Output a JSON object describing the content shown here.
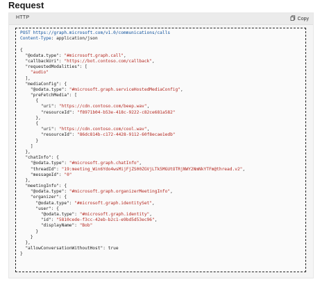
{
  "heading": "Request",
  "code_block": {
    "language": "HTTP",
    "copy_label": "Copy",
    "lines": [
      {
        "indent": 0,
        "parts": [
          {
            "t": "u",
            "v": "POST https://graph.microsoft.com/v1.0/communications/calls"
          }
        ]
      },
      {
        "indent": 0,
        "parts": [
          {
            "t": "u",
            "v": "Content-Type"
          },
          {
            "t": "p",
            "v": ": application/json"
          }
        ]
      },
      {
        "indent": 0,
        "parts": []
      },
      {
        "indent": 0,
        "parts": [
          {
            "t": "p",
            "v": "{"
          }
        ]
      },
      {
        "indent": 1,
        "parts": [
          {
            "t": "k",
            "v": "\"@odata.type\""
          },
          {
            "t": "p",
            "v": ": "
          },
          {
            "t": "s",
            "v": "\"#microsoft.graph.call\""
          },
          {
            "t": "p",
            "v": ","
          }
        ]
      },
      {
        "indent": 1,
        "parts": [
          {
            "t": "k",
            "v": "\"callbackUri\""
          },
          {
            "t": "p",
            "v": ": "
          },
          {
            "t": "s",
            "v": "\"https://bot.contoso.com/callback\""
          },
          {
            "t": "p",
            "v": ","
          }
        ]
      },
      {
        "indent": 1,
        "parts": [
          {
            "t": "k",
            "v": "\"requestedModalities\""
          },
          {
            "t": "p",
            "v": ": ["
          }
        ]
      },
      {
        "indent": 2,
        "parts": [
          {
            "t": "s",
            "v": "\"audio\""
          }
        ]
      },
      {
        "indent": 1,
        "parts": [
          {
            "t": "p",
            "v": "],"
          }
        ]
      },
      {
        "indent": 1,
        "parts": [
          {
            "t": "k",
            "v": "\"mediaConfig\""
          },
          {
            "t": "p",
            "v": ": {"
          }
        ]
      },
      {
        "indent": 2,
        "parts": [
          {
            "t": "k",
            "v": "\"@odata.type\""
          },
          {
            "t": "p",
            "v": ": "
          },
          {
            "t": "s",
            "v": "\"#microsoft.graph.serviceHostedMediaConfig\""
          },
          {
            "t": "p",
            "v": ","
          }
        ]
      },
      {
        "indent": 2,
        "parts": [
          {
            "t": "k",
            "v": "\"preFetchMedia\""
          },
          {
            "t": "p",
            "v": ": ["
          }
        ]
      },
      {
        "indent": 3,
        "parts": [
          {
            "t": "p",
            "v": "{"
          }
        ]
      },
      {
        "indent": 4,
        "parts": [
          {
            "t": "k",
            "v": "\"uri\""
          },
          {
            "t": "p",
            "v": ": "
          },
          {
            "t": "s",
            "v": "\"https://cdn.contoso.com/beep.wav\""
          },
          {
            "t": "p",
            "v": ","
          }
        ]
      },
      {
        "indent": 4,
        "parts": [
          {
            "t": "k",
            "v": "\"resourceId\""
          },
          {
            "t": "p",
            "v": ": "
          },
          {
            "t": "s",
            "v": "\"f8971b04-b53e-418c-9222-c82ce681a582\""
          }
        ]
      },
      {
        "indent": 3,
        "parts": [
          {
            "t": "p",
            "v": "},"
          }
        ]
      },
      {
        "indent": 3,
        "parts": [
          {
            "t": "p",
            "v": "{"
          }
        ]
      },
      {
        "indent": 4,
        "parts": [
          {
            "t": "k",
            "v": "\"uri\""
          },
          {
            "t": "p",
            "v": ": "
          },
          {
            "t": "s",
            "v": "\"https://cdn.contoso.com/cool.wav\""
          },
          {
            "t": "p",
            "v": ","
          }
        ]
      },
      {
        "indent": 4,
        "parts": [
          {
            "t": "k",
            "v": "\"resourceId\""
          },
          {
            "t": "p",
            "v": ": "
          },
          {
            "t": "s",
            "v": "\"86dc814b-c172-4428-9112-60f8ecae1edb\""
          }
        ]
      },
      {
        "indent": 3,
        "parts": [
          {
            "t": "p",
            "v": "}"
          }
        ]
      },
      {
        "indent": 2,
        "parts": [
          {
            "t": "p",
            "v": "]"
          }
        ]
      },
      {
        "indent": 1,
        "parts": [
          {
            "t": "p",
            "v": "},"
          }
        ]
      },
      {
        "indent": 1,
        "parts": [
          {
            "t": "k",
            "v": "\"chatInfo\""
          },
          {
            "t": "p",
            "v": ": {"
          }
        ]
      },
      {
        "indent": 2,
        "parts": [
          {
            "t": "k",
            "v": "\"@odata.type\""
          },
          {
            "t": "p",
            "v": ": "
          },
          {
            "t": "s",
            "v": "\"#microsoft.graph.chatInfo\""
          },
          {
            "t": "p",
            "v": ","
          }
        ]
      },
      {
        "indent": 2,
        "parts": [
          {
            "t": "k",
            "v": "\"threadId\""
          },
          {
            "t": "p",
            "v": ": "
          },
          {
            "t": "s",
            "v": "\"19:meeting_Win6Ydo4wsMijFjZS00ZGVjLTk5MGUtOTRjNWY2NmNkYTFm@thread.v2\""
          },
          {
            "t": "p",
            "v": ","
          }
        ]
      },
      {
        "indent": 2,
        "parts": [
          {
            "t": "k",
            "v": "\"messageId\""
          },
          {
            "t": "p",
            "v": ": "
          },
          {
            "t": "s",
            "v": "\"0\""
          }
        ]
      },
      {
        "indent": 1,
        "parts": [
          {
            "t": "p",
            "v": "},"
          }
        ]
      },
      {
        "indent": 1,
        "parts": [
          {
            "t": "k",
            "v": "\"meetingInfo\""
          },
          {
            "t": "p",
            "v": ": {"
          }
        ]
      },
      {
        "indent": 2,
        "parts": [
          {
            "t": "k",
            "v": "\"@odata.type\""
          },
          {
            "t": "p",
            "v": ": "
          },
          {
            "t": "s",
            "v": "\"#microsoft.graph.organizerMeetingInfo\""
          },
          {
            "t": "p",
            "v": ","
          }
        ]
      },
      {
        "indent": 2,
        "parts": [
          {
            "t": "k",
            "v": "\"organizer\""
          },
          {
            "t": "p",
            "v": ": {"
          }
        ]
      },
      {
        "indent": 3,
        "parts": [
          {
            "t": "k",
            "v": "\"@odata.type\""
          },
          {
            "t": "p",
            "v": ": "
          },
          {
            "t": "s",
            "v": "\"#microsoft.graph.identitySet\""
          },
          {
            "t": "p",
            "v": ","
          }
        ]
      },
      {
        "indent": 3,
        "parts": [
          {
            "t": "k",
            "v": "\"user\""
          },
          {
            "t": "p",
            "v": ": {"
          }
        ]
      },
      {
        "indent": 4,
        "parts": [
          {
            "t": "k",
            "v": "\"@odata.type\""
          },
          {
            "t": "p",
            "v": ": "
          },
          {
            "t": "s",
            "v": "\"#microsoft.graph.identity\""
          },
          {
            "t": "p",
            "v": ","
          }
        ]
      },
      {
        "indent": 4,
        "parts": [
          {
            "t": "k",
            "v": "\"id\""
          },
          {
            "t": "p",
            "v": ": "
          },
          {
            "t": "s",
            "v": "\"5810cede-f3cc-42eb-b2c1-e9bd5d53ec96\""
          },
          {
            "t": "p",
            "v": ","
          }
        ]
      },
      {
        "indent": 4,
        "parts": [
          {
            "t": "k",
            "v": "\"displayName\""
          },
          {
            "t": "p",
            "v": ": "
          },
          {
            "t": "s",
            "v": "\"Bob\""
          }
        ]
      },
      {
        "indent": 3,
        "parts": [
          {
            "t": "p",
            "v": "}"
          }
        ]
      },
      {
        "indent": 2,
        "parts": [
          {
            "t": "p",
            "v": "}"
          }
        ]
      },
      {
        "indent": 1,
        "parts": [
          {
            "t": "p",
            "v": "},"
          }
        ]
      },
      {
        "indent": 1,
        "parts": [
          {
            "t": "k",
            "v": "\"allowConversationWithoutHost\""
          },
          {
            "t": "p",
            "v": ": "
          },
          {
            "t": "k",
            "v": "true"
          }
        ]
      },
      {
        "indent": 0,
        "parts": [
          {
            "t": "p",
            "v": "}"
          }
        ]
      }
    ]
  },
  "icons": {
    "copy": "copy-icon"
  },
  "colors": {
    "string": "#b3261e",
    "key": "#1b1b1b",
    "url": "#0b4f9c",
    "background": "#f5f5f5"
  }
}
